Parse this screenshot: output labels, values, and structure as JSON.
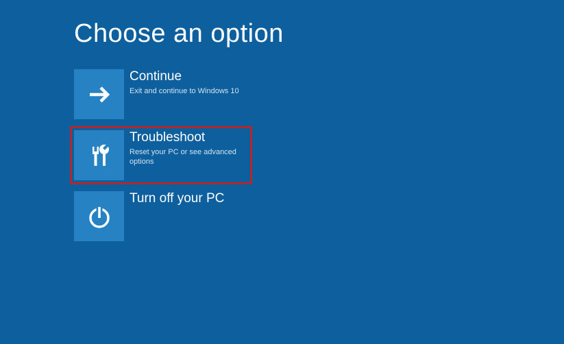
{
  "page": {
    "title": "Choose an option"
  },
  "options": {
    "continue": {
      "title": "Continue",
      "subtitle": "Exit and continue to Windows 10"
    },
    "troubleshoot": {
      "title": "Troubleshoot",
      "subtitle": "Reset your PC or see advanced options"
    },
    "turnoff": {
      "title": "Turn off your PC"
    }
  },
  "colors": {
    "background": "#0e5f9e",
    "tile": "#2682c3",
    "highlight": "#b1282d"
  }
}
